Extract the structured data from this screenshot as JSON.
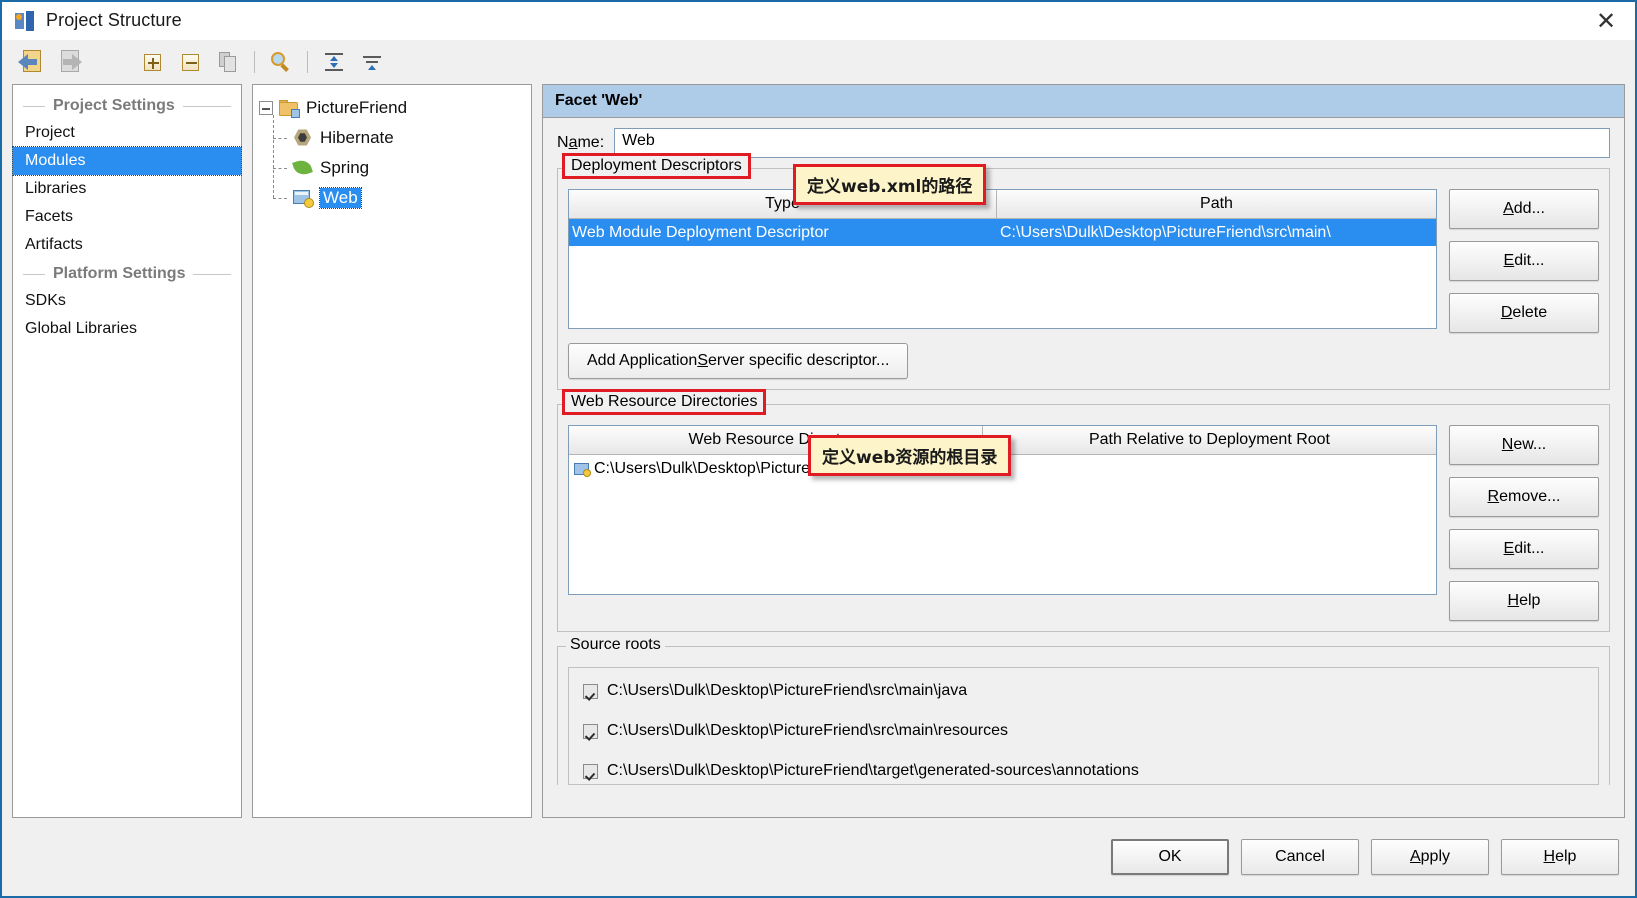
{
  "window": {
    "title": "Project Structure",
    "close_label": "✕",
    "app_icon": "intellij-idea-icon"
  },
  "toolbar": {
    "buttons": [
      {
        "name": "back-button",
        "icon": "back-arrow-icon"
      },
      {
        "name": "forward-button",
        "icon": "forward-arrow-icon"
      },
      {
        "name": "add-button",
        "icon": "plus-icon"
      },
      {
        "name": "remove-button",
        "icon": "minus-icon"
      },
      {
        "name": "copy-button",
        "icon": "copy-icon"
      },
      {
        "name": "find-button",
        "icon": "magnifier-icon"
      },
      {
        "name": "expand-all-button",
        "icon": "expand-all-icon"
      },
      {
        "name": "collapse-all-button",
        "icon": "collapse-all-icon"
      }
    ]
  },
  "sidebar": {
    "groups": [
      {
        "header": "Project Settings",
        "items": [
          {
            "label": "Project",
            "selected": false
          },
          {
            "label": "Modules",
            "selected": true
          },
          {
            "label": "Libraries",
            "selected": false
          },
          {
            "label": "Facets",
            "selected": false
          },
          {
            "label": "Artifacts",
            "selected": false
          }
        ]
      },
      {
        "header": "Platform Settings",
        "items": [
          {
            "label": "SDKs",
            "selected": false
          },
          {
            "label": "Global Libraries",
            "selected": false
          }
        ]
      }
    ]
  },
  "tree": {
    "root": {
      "label": "PictureFriend",
      "icon": "module-folder-icon",
      "expanded": true
    },
    "children": [
      {
        "label": "Hibernate",
        "icon": "hibernate-icon",
        "selected": false
      },
      {
        "label": "Spring",
        "icon": "spring-leaf-icon",
        "selected": false
      },
      {
        "label": "Web",
        "icon": "web-facet-icon",
        "selected": true
      }
    ]
  },
  "facet": {
    "header": "Facet 'Web'",
    "name_label": "Name:",
    "name_label_pre": "N",
    "name_label_mnemonic": "a",
    "name_label_post": "me:",
    "name_value": "Web",
    "deployment": {
      "legend": "Deployment Descriptors",
      "columns": [
        "Type",
        "Path"
      ],
      "rows": [
        {
          "type": "Web Module Deployment Descriptor",
          "path": "C:\\Users\\Dulk\\Desktop\\PictureFriend\\src\\main\\",
          "selected": true
        }
      ],
      "add_server_descriptor_label": "Add Application Server specific descriptor...",
      "add_server_descriptor_pre": "Add Application ",
      "add_server_descriptor_mnemonic": "S",
      "add_server_descriptor_post": "erver specific descriptor...",
      "buttons": [
        {
          "pre": "",
          "mnemonic": "A",
          "post": "dd...",
          "full": "Add..."
        },
        {
          "pre": "",
          "mnemonic": "E",
          "post": "dit...",
          "full": "Edit..."
        },
        {
          "pre": "",
          "mnemonic": "D",
          "post": "elete",
          "full": "Delete"
        }
      ]
    },
    "web_resources": {
      "legend": "Web Resource Directories",
      "columns": [
        "Web Resource Directory",
        "Path Relative to Deployment Root"
      ],
      "rows": [
        {
          "directory": "C:\\Users\\Dulk\\Desktop\\PictureFriend\\src...",
          "relative": "/"
        }
      ],
      "buttons": [
        {
          "pre": "",
          "mnemonic": "N",
          "post": "ew...",
          "full": "New..."
        },
        {
          "pre": "",
          "mnemonic": "R",
          "post": "emove...",
          "full": "Remove..."
        },
        {
          "pre": "",
          "mnemonic": "E",
          "post": "dit...",
          "full": "Edit..."
        },
        {
          "pre": "",
          "mnemonic": "H",
          "post": "elp",
          "full": "Help"
        }
      ]
    },
    "source_roots": {
      "legend": "Source roots",
      "items": [
        {
          "path": "C:\\Users\\Dulk\\Desktop\\PictureFriend\\src\\main\\java",
          "checked": true
        },
        {
          "path": "C:\\Users\\Dulk\\Desktop\\PictureFriend\\src\\main\\resources",
          "checked": true
        },
        {
          "path": "C:\\Users\\Dulk\\Desktop\\PictureFriend\\target\\generated-sources\\annotations",
          "checked": true
        }
      ]
    }
  },
  "annotations": [
    {
      "text": "定义web.xml的路径",
      "name": "annotation-webxml-path"
    },
    {
      "text": "定义web资源的根目录",
      "name": "annotation-web-resource-root"
    }
  ],
  "footer": {
    "ok": {
      "full": "OK"
    },
    "cancel": {
      "full": "Cancel"
    },
    "apply": {
      "pre": "",
      "mnemonic": "A",
      "post": "pply",
      "full": "Apply"
    },
    "help": {
      "pre": "",
      "mnemonic": "H",
      "post": "elp",
      "full": "Help"
    }
  },
  "colors": {
    "accent_selection": "#2a8ef0",
    "facet_header": "#aecbe8",
    "annotation_border": "#e01b24",
    "annotation_bg": "#fdf5c9",
    "window_border": "#1a6ba8"
  }
}
